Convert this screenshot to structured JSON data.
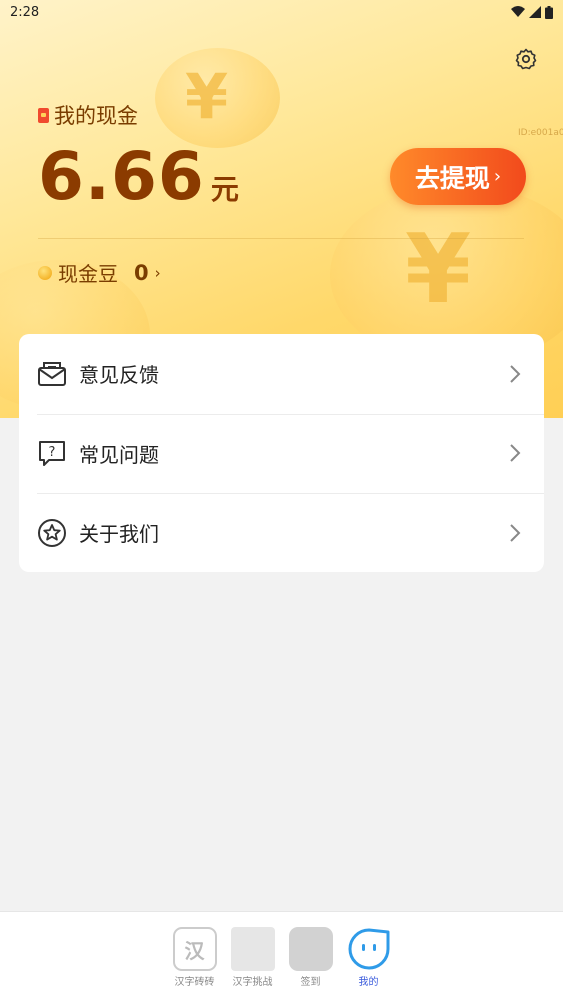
{
  "status_bar": {
    "time": "2:28"
  },
  "wallet": {
    "title": "我的现金",
    "user_id": "ID:e001a0",
    "amount": "6.66",
    "unit": "元",
    "withdraw_label": "去提现",
    "beans_label": "现金豆",
    "beans_count": "0"
  },
  "menu": {
    "items": [
      {
        "label": "意见反馈"
      },
      {
        "label": "常见问题"
      },
      {
        "label": "关于我们"
      }
    ]
  },
  "tabbar": {
    "tabs": [
      {
        "label": "汉字砖砖",
        "icon_text": "汉"
      },
      {
        "label": "汉字挑战"
      },
      {
        "label": "签到"
      },
      {
        "label": "我的"
      }
    ]
  },
  "colors": {
    "accent_orange": "#f24a1c",
    "amount_brown": "#8b3b00",
    "active_tab": "#3a5bdc"
  }
}
